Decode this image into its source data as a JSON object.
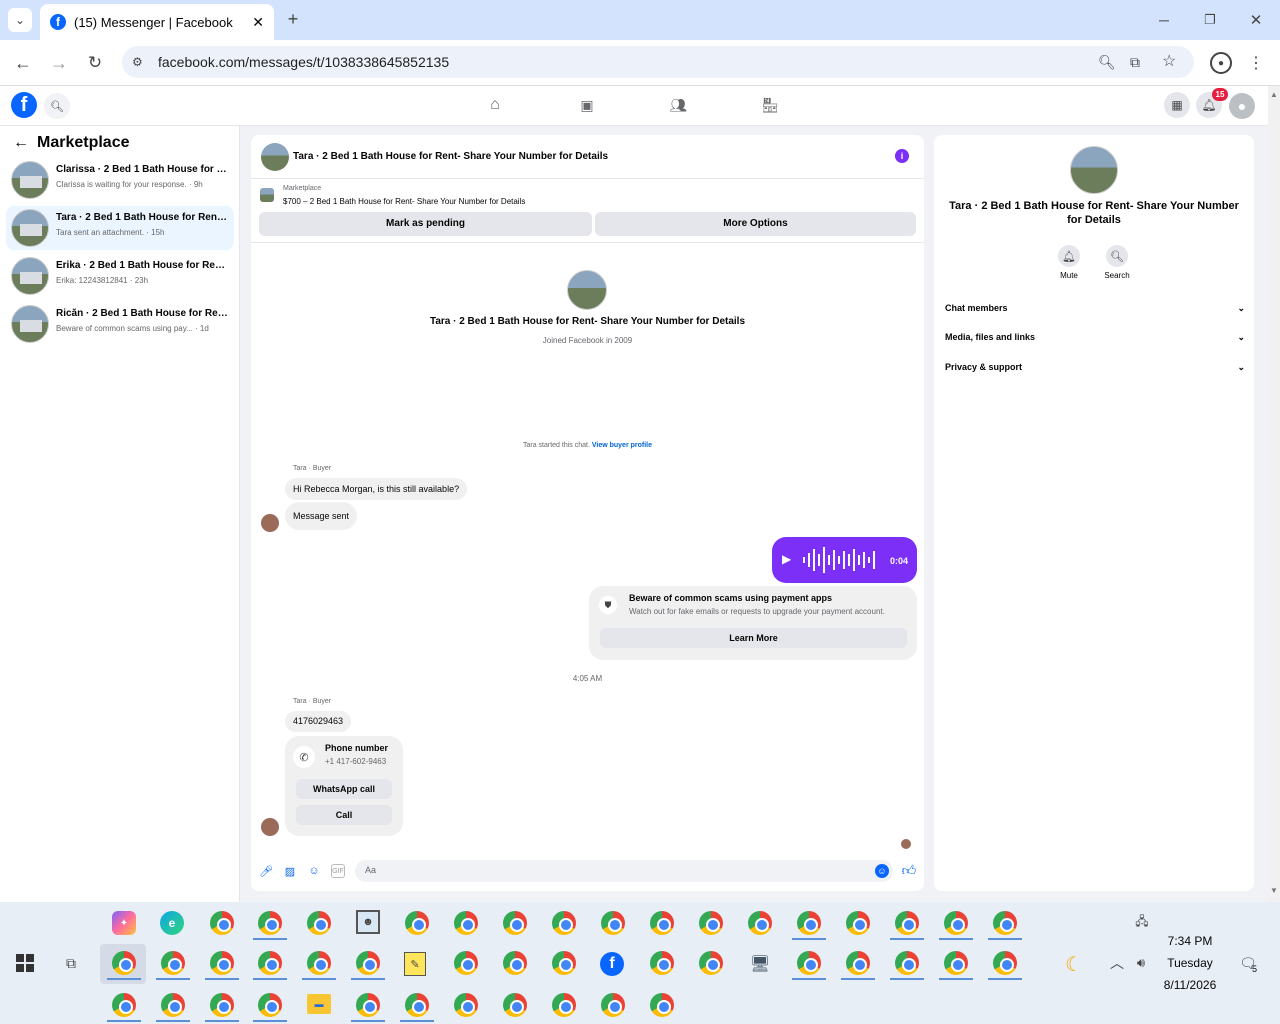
{
  "browser": {
    "tab_title": "(15) Messenger | Facebook",
    "url": "facebook.com/messages/t/1038338645852135"
  },
  "fbnav": {
    "notif_count": "15"
  },
  "leftcol": {
    "title": "Marketplace",
    "conversations": [
      {
        "title": "Clarissa · 2 Bed 1 Bath House for R...",
        "preview": "Clarissa is waiting for your response. · 9h"
      },
      {
        "title": "Tara · 2 Bed 1 Bath House for Rent-...",
        "preview": "Tara sent an attachment. · 15h"
      },
      {
        "title": "Erika · 2 Bed 1 Bath House for Rent...",
        "preview": "Erika: 12243812841 · 23h"
      },
      {
        "title": "Ricăn · 2 Bed 1 Bath House for Ren...",
        "preview": "Beware of common scams using pay... · 1d"
      }
    ]
  },
  "chat": {
    "header_title": "Tara · 2 Bed 1 Bath House for Rent- Share Your Number for Details",
    "listing_label": "Marketplace",
    "listing_text": "$700 – 2 Bed 1 Bath House for Rent- Share Your Number for Details",
    "mark_pending": "Mark as pending",
    "more_options": "More Options",
    "profile_name": "Tara · 2 Bed 1 Bath House for Rent- Share Your Number for Details",
    "joined": "Joined Facebook in 2009",
    "started_text": "Tara started this chat.",
    "view_profile": "View buyer profile",
    "sender_label": "Tara · Buyer",
    "msg1": "Hi Rebecca Morgan, is this still available?",
    "msg2": "Message sent",
    "voice_duration": "0:04",
    "scam_title": "Beware of common scams using payment apps",
    "scam_text": "Watch out for fake emails or requests to upgrade your payment account.",
    "learn_more": "Learn More",
    "timestamp": "4:05 AM",
    "sender_label2": "Tara · Buyer",
    "msg3": "4176029463",
    "phone_title": "Phone number",
    "phone_number": "+1 417-602-9463",
    "whatsapp": "WhatsApp call",
    "call": "Call",
    "input_placeholder": "Aa"
  },
  "right": {
    "title": "Tara · 2 Bed 1 Bath House for Rent- Share Your Number for Details",
    "mute": "Mute",
    "search": "Search",
    "sections": [
      "Chat members",
      "Media, files and links",
      "Privacy & support"
    ]
  },
  "taskbar": {
    "time": "7:34 PM",
    "day": "Tuesday",
    "date": "8/11/2026",
    "notif": "5"
  },
  "colors": {
    "accent": "#7b2ff7",
    "fb_blue": "#0866ff"
  }
}
